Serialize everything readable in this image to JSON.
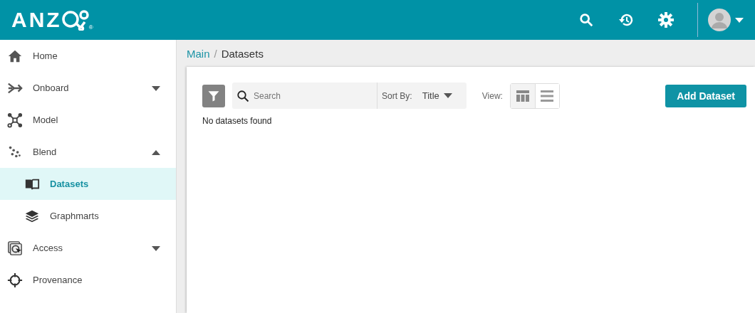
{
  "header": {
    "logo": "ANZ",
    "registered": "®"
  },
  "sidebar": {
    "items": [
      {
        "label": "Home",
        "kind": "home",
        "selected": false
      },
      {
        "label": "Onboard",
        "kind": "onboard",
        "selected": false,
        "expanded": false
      },
      {
        "label": "Model",
        "kind": "model",
        "selected": false
      },
      {
        "label": "Blend",
        "kind": "blend",
        "selected": false,
        "expanded": true,
        "children": [
          {
            "label": "Datasets",
            "kind": "book",
            "selected": true
          },
          {
            "label": "Graphmarts",
            "kind": "layers",
            "selected": false
          }
        ]
      },
      {
        "label": "Access",
        "kind": "access",
        "selected": false,
        "expanded": false
      },
      {
        "label": "Provenance",
        "kind": "target",
        "selected": false
      }
    ]
  },
  "breadcrumb": {
    "link": "Main",
    "separator": "/",
    "current": "Datasets"
  },
  "toolbar": {
    "search": {
      "placeholder": "Search"
    },
    "sort_label": "Sort By:",
    "sort_value": "Title",
    "view_label": "View:",
    "views": [
      {
        "kind": "grid",
        "selected": true
      },
      {
        "kind": "list",
        "selected": false
      }
    ],
    "add_button": "Add Dataset"
  },
  "empty_message": "No datasets found"
}
